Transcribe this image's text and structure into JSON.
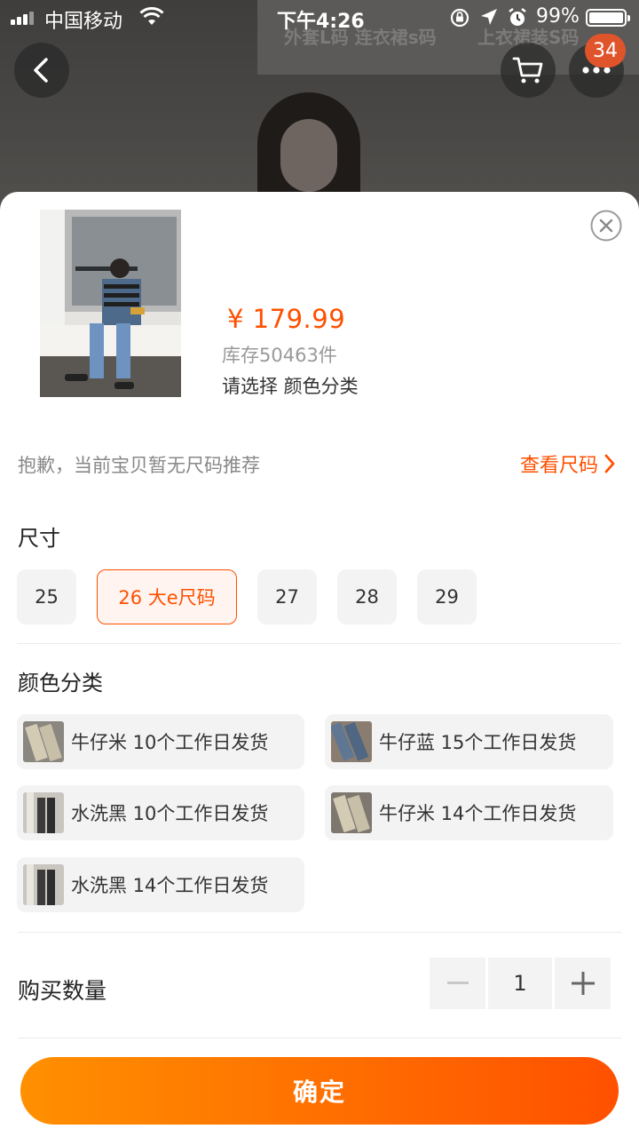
{
  "status_bar": {
    "carrier": "中国移动",
    "time": "下午4:26",
    "battery": "99%"
  },
  "backdrop": {
    "board_text_left": "外套L码 连衣裙s码",
    "board_text_right": "上衣裙装S码"
  },
  "header": {
    "badge_count": "34"
  },
  "product": {
    "price": "¥ 179.99",
    "stock": "库存50463件",
    "selection_prompt": "请选择 颜色分类"
  },
  "size_recommend": {
    "tip": "抱歉，当前宝贝暂无尺码推荐",
    "link": "查看尺码"
  },
  "size": {
    "title": "尺寸",
    "options": [
      {
        "label": "25",
        "selected": false
      },
      {
        "label": "26 大e尺码",
        "selected": true
      },
      {
        "label": "27",
        "selected": false
      },
      {
        "label": "28",
        "selected": false
      },
      {
        "label": "29",
        "selected": false
      }
    ]
  },
  "color": {
    "title": "颜色分类",
    "options": [
      {
        "label": "牛仔米 10个工作日发货",
        "swatch": "#c8bfa9"
      },
      {
        "label": "牛仔蓝 15个工作日发货",
        "swatch": "#5f7792"
      },
      {
        "label": "水洗黑 10个工作日发货",
        "swatch": "#3c3b3c"
      },
      {
        "label": "牛仔米 14个工作日发货",
        "swatch": "#c8bfa9"
      },
      {
        "label": "水洗黑 14个工作日发货",
        "swatch": "#3c3b3c"
      }
    ]
  },
  "quantity": {
    "label": "购买数量",
    "value": "1"
  },
  "confirm_label": "确定",
  "colors": {
    "accent": "#ff5000",
    "button_gradient_start": "#ff9000",
    "button_gradient_end": "#ff5000",
    "option_bg": "#f3f3f3"
  }
}
